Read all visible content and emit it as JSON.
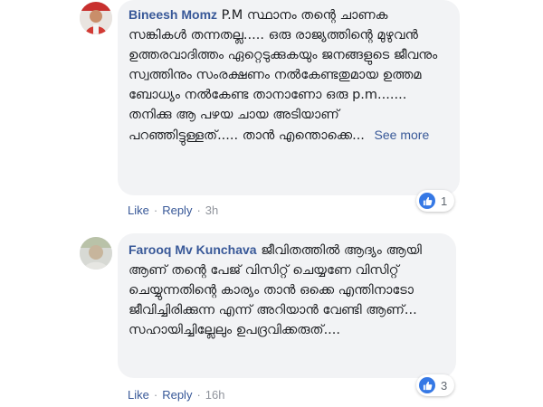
{
  "comments": [
    {
      "author": "Bineesh Momz",
      "text": "P.M സ്ഥാനം തന്റെ ചാണക സങ്കികൾ തന്നതല്ല..... ഒരു രാജ്യത്തിന്റെ മുഴുവൻ ഉത്തരവാദിത്തം ഏറ്റെടുക്കുകയും ജനങ്ങളുടെ ജീവനും സ്വത്തിനും സംരക്ഷണം നൽകേണ്ടതുമായ ഉത്തമ ബോധ്യം നൽകേണ്ട താനാണോ ഒരു p.m....... തനിക്കു ആ പഴയ ചായ അടിയാണ് പറഞ്ഞിട്ടുള്ളത്..... താൻ എന്തൊക്കെ...",
      "see_more": "See more",
      "reaction_count": "1",
      "like_label": "Like",
      "reply_label": "Reply",
      "separator": "·",
      "time": "3h"
    },
    {
      "author": "Farooq Mv Kunchava",
      "text": "ജീവിതത്തിൽ ആദ്യം ആയി ആണ് തന്റെ പേജ് വിസിറ്റ് ചെയ്യണേ വിസിറ്റ് ചെയ്യുന്നതിന്റെ കാര്യം താൻ ഒക്കെ എന്തിനാടോ ജീവിച്ചിരിക്കുന്ന എന്ന് അറിയാൻ വേണ്ടി ആണ്... സഹായിച്ചില്ലേലും ഉപദ്രവിക്കരുത്....",
      "see_more": "",
      "reaction_count": "3",
      "like_label": "Like",
      "reply_label": "Reply",
      "separator": "·",
      "time": "16h"
    }
  ],
  "icons": {
    "reaction": "like-thumb-icon",
    "reaction_color": "#3578e5",
    "link_color": "#385898"
  }
}
